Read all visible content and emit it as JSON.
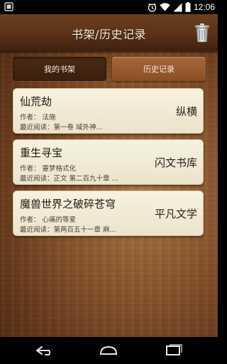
{
  "status_bar": {
    "time": "12:06",
    "icons": [
      "notification-icon",
      "alarm-icon",
      "wifi-icon",
      "signal-icon",
      "battery-icon"
    ]
  },
  "header": {
    "title": "书架/历史记录",
    "trash_icon": "trash-icon"
  },
  "tabs": [
    {
      "label": "我的书架",
      "selected": true
    },
    {
      "label": "历史记录",
      "selected": false
    }
  ],
  "books": [
    {
      "title": "仙荒劫",
      "author": "作者： 法施",
      "recent": "最近阅读：第一卷 域外神...",
      "source": "纵横"
    },
    {
      "title": "重生寻宝",
      "author": "作者： 靈梦格式化",
      "recent": "最近阅读：正文 第二百九十章 ...",
      "source": "闪文书库"
    },
    {
      "title": "魔兽世界之破碎苍穹",
      "author": "作者： 心痛的等爱",
      "recent": "最近阅读：第两百五十一章 麻...",
      "source": "平凡文学"
    }
  ],
  "nav": [
    "back-icon",
    "home-icon",
    "recent-apps-icon"
  ]
}
